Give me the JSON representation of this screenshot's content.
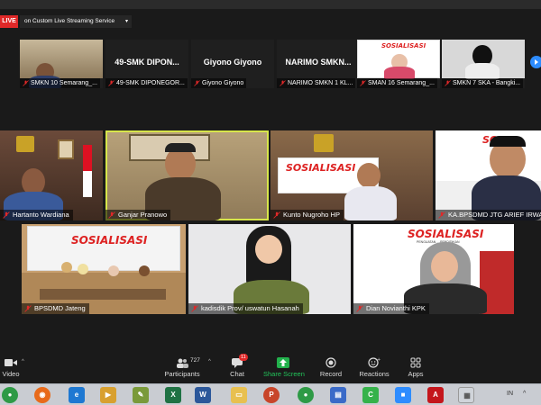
{
  "top_bar": {
    "live_label": "LIVE",
    "stream_service": "on Custom Live Streaming Service",
    "dropdown_caret": "▾"
  },
  "strip": [
    {
      "label": "SMKN 10 Semarang_...",
      "big_name": ""
    },
    {
      "label": "49-SMK DIPONEGOR...",
      "big_name": "49-SMK DIPON..."
    },
    {
      "label": "Giyono Giyono",
      "big_name": "Giyono Giyono"
    },
    {
      "label": "NARIMO SMKN 1 KL...",
      "big_name": "NARIMO SMKN..."
    },
    {
      "label": "SMAN 16 Semarang_...",
      "big_name": ""
    },
    {
      "label": "SMKN 7 SKA - Bangki...",
      "big_name": ""
    }
  ],
  "strip_banner_title": "SOSIALISASI",
  "tiles": {
    "t1": {
      "label": "Hartanto Wardiana"
    },
    "t2": {
      "label": "Ganjar Pranowo"
    },
    "t3": {
      "label": "Kunto Nugroho HP",
      "banner": "SOSIALISASI"
    },
    "t4": {
      "label": "KA.BPSDMD JTG ARIEF IRWANTO",
      "banner": "SOSI"
    },
    "t5": {
      "label": "BPSDMD Jateng",
      "banner": "SOSIALISASI"
    },
    "t6": {
      "label": "kadisdik Prov/ uswatun Hasanah"
    },
    "t7": {
      "label": "Dian Novianthi KPK",
      "banner": "SOSIALISASI",
      "sub": "PENGUATAN ... PENDIDIKAN"
    }
  },
  "toolbar": {
    "video": "Video",
    "participants": "Participants",
    "participants_count": "727",
    "chat": "Chat",
    "chat_badge": "11",
    "share_screen": "Share Screen",
    "record": "Record",
    "reactions": "Reactions",
    "apps": "Apps",
    "caret": "^"
  },
  "taskbar": {
    "tray_lang": "IN",
    "tray_caret": "^"
  },
  "colors": {
    "live_red": "#e02828",
    "speaker_highlight": "#d7e64a",
    "share_green": "#22b14c",
    "zoom_blue": "#2d8cff"
  }
}
